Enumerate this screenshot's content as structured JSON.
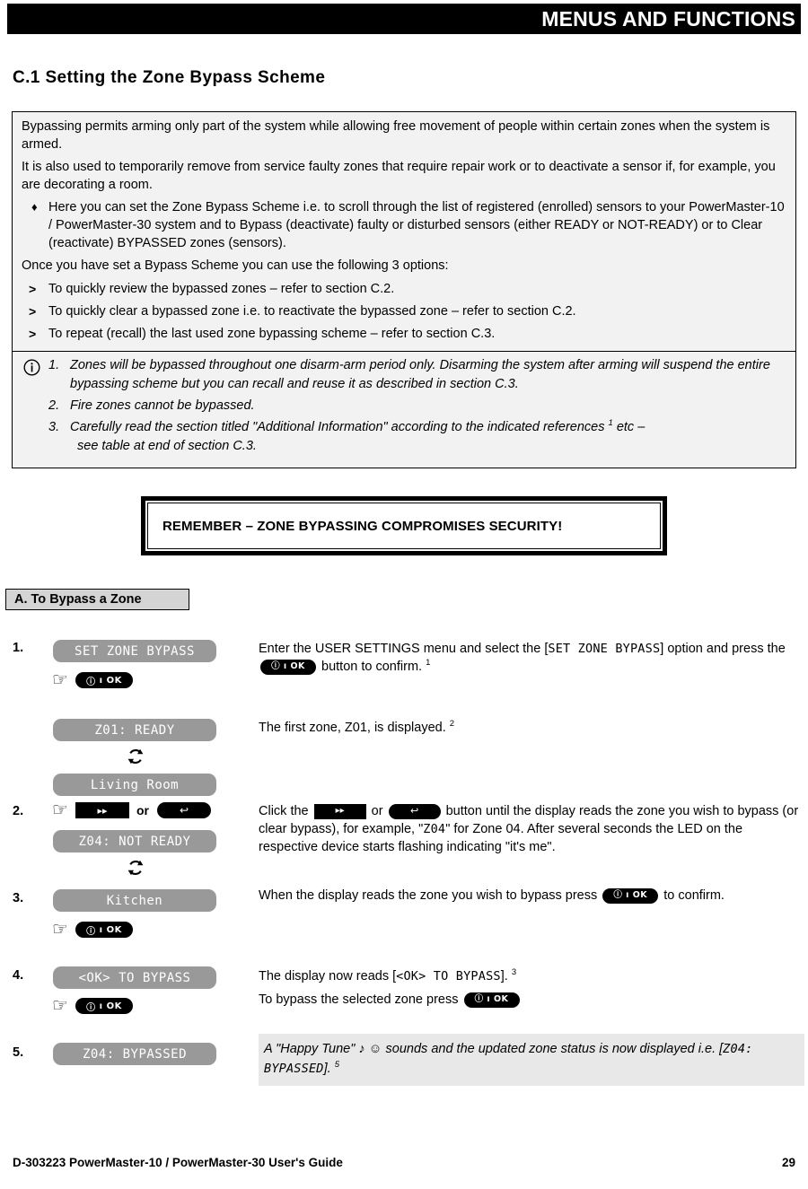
{
  "header": {
    "title": "MENUS AND FUNCTIONS"
  },
  "section": {
    "heading": "C.1 Setting the Zone Bypass Scheme"
  },
  "info_box": {
    "paragraph_1": "Bypassing permits arming only part of the system while allowing free movement of people within certain zones when the system is armed.",
    "paragraph_2": "It is also used to temporarily remove from service faulty zones that require repair work or to deactivate a sensor if, for example, you are decorating a room.",
    "bullet_marker": "♦",
    "bullet_1": "Here you can set the Zone Bypass Scheme i.e. to scroll through the list of registered (enrolled) sensors to your PowerMaster-10 / PowerMaster-30 system and to Bypass (deactivate) faulty or disturbed sensors (either READY or NOT-READY) or to Clear (reactivate) BYPASSED zones (sensors).",
    "paragraph_3": "Once you have set a Bypass Scheme you can use the following 3 options:",
    "option_marker": ">",
    "options": [
      "To quickly review the bypassed zones – refer to section C.2.",
      "To quickly clear a bypassed zone i.e. to reactivate the bypassed zone – refer to section C.2.",
      "To repeat (recall) the last used zone bypassing scheme – refer to section C.3."
    ]
  },
  "notes": {
    "icon": "info-circle-icon",
    "items": [
      {
        "text": "Zones will be bypassed throughout one disarm-arm period only. Disarming the system after arming will suspend the entire bypassing scheme but you can recall and reuse it as described in section C.3."
      },
      {
        "text": "Fire zones cannot be bypassed."
      },
      {
        "text": "Carefully read the section titled \"Additional Information\" according to the indicated references ",
        "sup": "1",
        "text_after": " etc –",
        "continuation": "see table at end of section C.3."
      }
    ]
  },
  "remember": {
    "text": "REMEMBER – ZONE BYPASSING COMPROMISES SECURITY!"
  },
  "subsection": {
    "label": "A. To Bypass a Zone"
  },
  "buttons": {
    "ok_label": "ı OK",
    "ok_info_glyph": "ⓘ",
    "next_glyph": "▸▸",
    "back_glyph": "↩",
    "or_label": "or",
    "hand_glyph": "☞"
  },
  "steps": [
    {
      "number": "1.",
      "displays": [
        "SET ZONE BYPASS"
      ],
      "desc_line_1_a": "Enter the USER SETTINGS menu and select the [",
      "desc_lcd_1": "SET ZONE BYPASS",
      "desc_line_1_b": "] option and press the ",
      "desc_line_1_c": " button to confirm. ",
      "desc_sup": "1"
    },
    {
      "number": "",
      "displays": [
        "Z01: READY",
        "Living Room"
      ],
      "desc_line": "The first zone, Z01, is displayed. ",
      "desc_sup": "2"
    },
    {
      "number": "2.",
      "displays": [
        "Z04: NOT READY"
      ],
      "desc_a": "Click the ",
      "desc_b": " or ",
      "desc_c": " button until the display reads the zone you wish to bypass (or clear bypass), for example, \"",
      "desc_lcd": "Z04",
      "desc_d": "\" for Zone 04. After several seconds the LED on the respective device starts flashing indicating \"it's me\"."
    },
    {
      "number": "3.",
      "displays": [
        "Kitchen"
      ],
      "desc_a": "When the display reads the zone you wish to bypass press ",
      "desc_b": " to confirm."
    },
    {
      "number": "4.",
      "displays": [
        "<OK> TO BYPASS"
      ],
      "desc_a": "The display now reads [",
      "desc_lcd": "<OK> TO BYPASS",
      "desc_b": "]. ",
      "desc_sup": "3",
      "desc_line_2_a": "To bypass the selected zone press ",
      "desc_line_2_b": ""
    },
    {
      "number": "5.",
      "displays": [
        "Z04: BYPASSED"
      ],
      "note_a": "A \"Happy Tune\" ",
      "note_glyphs": "♪ ☺",
      "note_b": " sounds and the updated zone status is now displayed i.e. [",
      "note_lcd": "Z04: BYPASSED",
      "note_c": "]. ",
      "note_sup": "5"
    }
  ],
  "footer": {
    "left": "D-303223 PowerMaster-10 / PowerMaster-30 User's Guide",
    "right": "29"
  }
}
